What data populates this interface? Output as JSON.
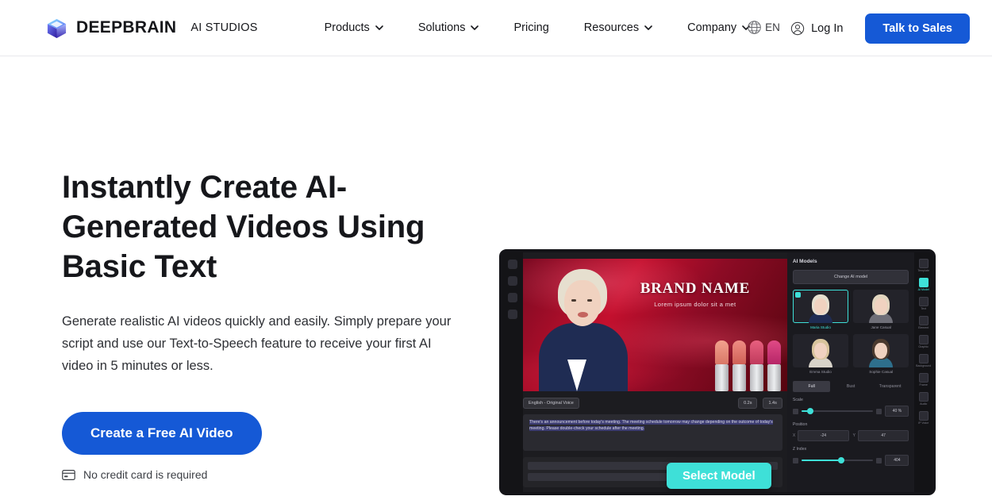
{
  "header": {
    "logo_icon": "cube-logo-icon",
    "brand_name": "DEEPBRAIN",
    "brand_sub": "AI STUDIOS",
    "nav": [
      {
        "label": "Products",
        "has_dropdown": true
      },
      {
        "label": "Solutions",
        "has_dropdown": true
      },
      {
        "label": "Pricing",
        "has_dropdown": false
      },
      {
        "label": "Resources",
        "has_dropdown": true
      },
      {
        "label": "Company",
        "has_dropdown": true
      }
    ],
    "language": {
      "icon": "globe-icon",
      "label": "EN"
    },
    "login": {
      "icon": "user-circle-icon",
      "label": "Log In"
    },
    "cta": "Talk to Sales"
  },
  "hero": {
    "title": "Instantly Create AI-Generated Videos Using Basic Text",
    "description": "Generate realistic AI videos quickly and easily. Simply prepare your script and use our Text-to-Speech feature to receive your first AI video in 5 minutes or less.",
    "cta_label": "Create a Free AI Video",
    "note_icon": "credit-card-icon",
    "note": "No credit card is required"
  },
  "mock": {
    "stage": {
      "brand_title": "BRAND NAME",
      "brand_subtitle": "Lorem ipsum dolor sit a met"
    },
    "toolbar": {
      "voice_chip": "English - Original Voice",
      "chips": [
        "0.2s",
        "1.4s"
      ]
    },
    "script_text": "There's an announcement before today's meeting. The meeting schedule tomorrow may change depending on the outcome of today's meeting. Please double-check your schedule after the meeting.",
    "select_model_button": "Select Model",
    "panel": {
      "title": "AI Models",
      "change_button": "Change AI model",
      "models": [
        {
          "name": "Maria Studio",
          "selected": true
        },
        {
          "name": "Jane Casual",
          "selected": false
        },
        {
          "name": "Emma Studio",
          "selected": false
        },
        {
          "name": "Sophie Casual",
          "selected": false
        }
      ],
      "tabs": [
        {
          "label": "Full",
          "active": true
        },
        {
          "label": "Bust",
          "active": false
        },
        {
          "label": "Transparent",
          "active": false
        }
      ],
      "controls": [
        {
          "label": "Scale",
          "value": "40 %",
          "fill_percent": 12
        },
        {
          "label": "Position",
          "x_label": "X",
          "x_value": "-24",
          "y_label": "Y",
          "y_value": "47"
        },
        {
          "label": "Z Index",
          "value": "404",
          "fill_percent": 55
        }
      ]
    },
    "rail": [
      {
        "label": "Template",
        "icon": "template-icon",
        "active": false
      },
      {
        "label": "AI Model",
        "icon": "ai-model-icon",
        "active": true
      },
      {
        "label": "Text",
        "icon": "text-icon",
        "active": false
      },
      {
        "label": "Element",
        "icon": "element-icon",
        "active": false
      },
      {
        "label": "Graphic",
        "icon": "graphic-icon",
        "active": false
      },
      {
        "label": "Background",
        "icon": "background-icon",
        "active": false
      },
      {
        "label": "Frame",
        "icon": "frame-icon",
        "active": false
      },
      {
        "label": "Audio",
        "icon": "audio-icon",
        "active": false
      },
      {
        "label": "IP Voice",
        "icon": "ip-voice-icon",
        "active": false
      }
    ]
  },
  "colors": {
    "brand_blue": "#1559d6",
    "accent_teal": "#3ee0d8",
    "text_dark": "#16171b",
    "page_bg": "#ffffff"
  }
}
